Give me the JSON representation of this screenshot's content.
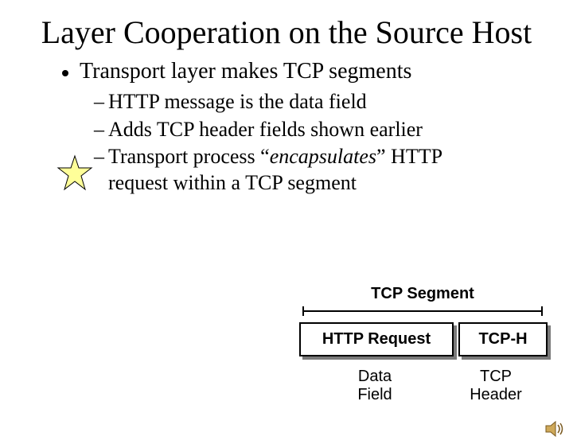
{
  "title": "Layer Cooperation on the Source Host",
  "bullet": "Transport layer makes TCP segments",
  "sub": [
    {
      "dash": "–",
      "text_a": "HTTP message is the data field"
    },
    {
      "dash": "–",
      "text_a": "Adds TCP header fields shown earlier"
    },
    {
      "dash": "–",
      "text_a": "Transport process “",
      "em": "encapsulates",
      "text_b": "” HTTP request within a TCP segment"
    }
  ],
  "diagram": {
    "segment_label": "TCP Segment",
    "left_box": "HTTP Request",
    "right_box": "TCP-H",
    "left_under_1": "Data",
    "left_under_2": "Field",
    "right_under_1": "TCP",
    "right_under_2": "Header"
  }
}
